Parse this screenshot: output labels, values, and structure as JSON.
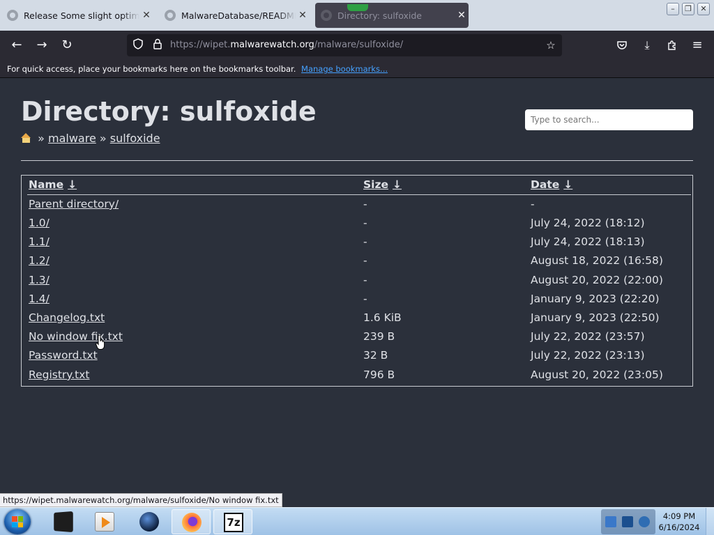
{
  "browser": {
    "tabs": [
      {
        "label": "Release Some slight optimizati"
      },
      {
        "label": "MalwareDatabase/README.md"
      },
      {
        "label": "Directory: sulfoxide"
      }
    ],
    "url": {
      "prefix": "https://wipet.",
      "host": "malwarewatch.org",
      "path": "/malware/sulfoxide/"
    },
    "bookmarks_text": "For quick access, place your bookmarks here on the bookmarks toolbar.",
    "bookmarks_link": "Manage bookmarks...",
    "status_url": "https://wipet.malwarewatch.org/malware/sulfoxide/No window fix.txt"
  },
  "page": {
    "title": "Directory: sulfoxide",
    "breadcrumb": [
      "malware",
      "sulfoxide"
    ],
    "separator": "»",
    "search_placeholder": "Type to search...",
    "headers": {
      "name": "Name",
      "size": "Size",
      "date": "Date",
      "sort_arrow": "↓"
    },
    "rows": [
      {
        "name": "Parent directory/",
        "size": "-",
        "date": "-"
      },
      {
        "name": "1.0/",
        "size": "-",
        "date": "July 24, 2022 (18:12)"
      },
      {
        "name": "1.1/",
        "size": "-",
        "date": "July 24, 2022 (18:13)"
      },
      {
        "name": "1.2/",
        "size": "-",
        "date": "August 18, 2022 (16:58)"
      },
      {
        "name": "1.3/",
        "size": "-",
        "date": "August 20, 2022 (22:00)"
      },
      {
        "name": "1.4/",
        "size": "-",
        "date": "January 9, 2023 (22:20)"
      },
      {
        "name": "Changelog.txt",
        "size": "1.6 KiB",
        "date": "January 9, 2023 (22:50)"
      },
      {
        "name": "No window fix.txt",
        "size": "239 B",
        "date": "July 22, 2022 (23:57)"
      },
      {
        "name": "Password.txt",
        "size": "32 B",
        "date": "July 22, 2022 (23:13)"
      },
      {
        "name": "Registry.txt",
        "size": "796 B",
        "date": "August 20, 2022 (23:05)"
      }
    ]
  },
  "taskbar": {
    "items": [
      "terminal-icon",
      "media-player-icon",
      "globe-icon",
      "firefox-icon",
      "7zip-icon"
    ],
    "seven_zip_label": "7z",
    "clock_time": "4:09 PM",
    "clock_date": "6/16/2024"
  },
  "colors": {
    "page_bg": "#2b303b",
    "text": "#dfe1e6",
    "chrome_bg": "#2b2a33",
    "link_blue": "#45a1ff"
  }
}
